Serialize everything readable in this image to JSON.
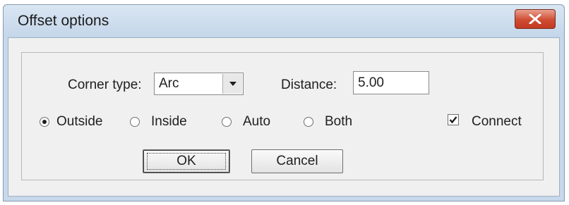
{
  "window": {
    "title": "Offset options"
  },
  "icons": {
    "close": "close-icon",
    "dropdown": "chevron-down-icon",
    "check": "checkmark-icon"
  },
  "form": {
    "corner_type_label": "Corner type:",
    "corner_type_value": "Arc",
    "distance_label": "Distance:",
    "distance_value": "5.00",
    "radios": [
      {
        "label": "Outside",
        "selected": true
      },
      {
        "label": "Inside",
        "selected": false
      },
      {
        "label": "Auto",
        "selected": false
      },
      {
        "label": "Both",
        "selected": false
      }
    ],
    "connect_label": "Connect",
    "connect_checked": true
  },
  "buttons": {
    "ok": "OK",
    "cancel": "Cancel"
  },
  "colors": {
    "close_button": "#cf4b32",
    "frame": "#c7d8ea",
    "dialog_bg": "#f0f0f0"
  }
}
